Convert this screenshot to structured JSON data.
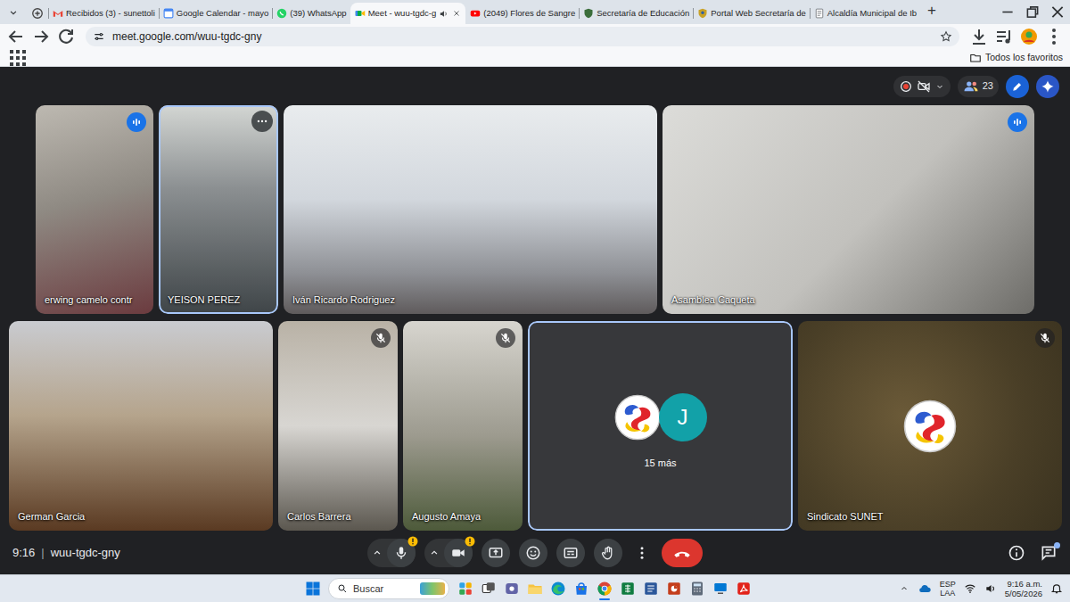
{
  "browser": {
    "tabs": [
      {
        "label": "Recibidos (3) - sunettoli",
        "selected": false,
        "audio": false
      },
      {
        "label": "Google Calendar - mayo",
        "selected": false,
        "audio": false
      },
      {
        "label": "(39) WhatsApp",
        "selected": false,
        "audio": false
      },
      {
        "label": "Meet - wuu-tgdc-g",
        "selected": true,
        "audio": true
      },
      {
        "label": "(2049) Flores de Sangre",
        "selected": false,
        "audio": false
      },
      {
        "label": "Secretaría de Educación",
        "selected": false,
        "audio": false
      },
      {
        "label": "Portal Web Secretaría de",
        "selected": false,
        "audio": false
      },
      {
        "label": "Alcaldía Municipal de Ib",
        "selected": false,
        "audio": false
      }
    ],
    "new_tab": "+",
    "url": "meet.google.com/wuu-tgdc-gny",
    "bookmarked": false,
    "bookmarks_folder": "Todos los favoritos"
  },
  "meet": {
    "participant_count": "23",
    "rows": [
      [
        {
          "kind": "video",
          "name": "erwing camelo contr",
          "speaking": true,
          "muted": false,
          "highlighted": false,
          "hovered": false
        },
        {
          "kind": "video",
          "name": "YEISON PEREZ",
          "speaking": false,
          "muted": false,
          "highlighted": true,
          "hovered": true
        },
        {
          "kind": "video",
          "name": "Iván Ricardo Rodriguez",
          "speaking": false,
          "muted": false,
          "highlighted": false,
          "hovered": false
        },
        {
          "kind": "video",
          "name": "Asamblea Caqueta",
          "speaking": true,
          "muted": false,
          "highlighted": false,
          "hovered": false
        }
      ],
      [
        {
          "kind": "video",
          "name": "German Garcia",
          "speaking": false,
          "muted": false,
          "highlighted": false,
          "hovered": false
        },
        {
          "kind": "video",
          "name": "Carlos Barrera",
          "speaking": false,
          "muted": true,
          "highlighted": false,
          "hovered": false
        },
        {
          "kind": "video",
          "name": "Augusto Amaya",
          "speaking": false,
          "muted": true,
          "highlighted": false,
          "hovered": false
        },
        {
          "kind": "overflow",
          "label": "15 más",
          "avatar_letter": "J",
          "speaking": false,
          "muted": false,
          "highlighted": true,
          "hovered": false
        },
        {
          "kind": "avatar",
          "name": "Sindicato SUNET",
          "speaking": false,
          "muted": true,
          "highlighted": false,
          "hovered": false
        }
      ]
    ],
    "time": "9:16",
    "separator": "|",
    "code": "wuu-tgdc-gny",
    "mic_warning": true,
    "camera_warning": true,
    "chat_unread": true
  },
  "taskbar": {
    "search_placeholder": "Buscar",
    "apps": [
      {
        "running": false,
        "active": false
      },
      {
        "running": false,
        "active": false
      },
      {
        "running": false,
        "active": false
      },
      {
        "running": false,
        "active": false
      },
      {
        "running": false,
        "active": false
      },
      {
        "running": false,
        "active": false
      },
      {
        "running": true,
        "active": true
      },
      {
        "running": false,
        "active": false
      },
      {
        "running": false,
        "active": false
      },
      {
        "running": false,
        "active": false
      },
      {
        "running": false,
        "active": false
      },
      {
        "running": false,
        "active": false
      },
      {
        "running": false,
        "active": false
      }
    ],
    "input_lang": "ESP",
    "input_layout": "LAA",
    "time": "9:16 a.m.",
    "date": "5/05/2026"
  }
}
